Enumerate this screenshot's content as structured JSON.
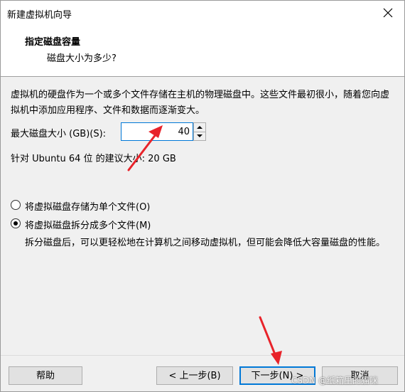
{
  "window": {
    "title": "新建虚拟机向导",
    "close_icon": "close-icon"
  },
  "header": {
    "title": "指定磁盘容量",
    "subtitle": "磁盘大小为多少?"
  },
  "description": "虚拟机的硬盘作为一个或多个文件存储在主机的物理磁盘中。这些文件最初很小，随着您向虚拟机中添加应用程序、文件和数据而逐渐变大。",
  "disk_size": {
    "label": "最大磁盘大小 (GB)(S):",
    "value": "40"
  },
  "recommendation": "针对 Ubuntu 64 位 的建议大小: 20 GB",
  "storage_options": [
    {
      "label": "将虚拟磁盘存储为单个文件(O)",
      "selected": false
    },
    {
      "label": "将虚拟磁盘拆分成多个文件(M)",
      "selected": true
    }
  ],
  "split_description": "拆分磁盘后，可以更轻松地在计算机之间移动虚拟机，但可能会降低大容量磁盘的性能。",
  "buttons": {
    "help": "帮助",
    "back": "< 上一步(B)",
    "next": "下一步(N) >",
    "cancel": "取消"
  },
  "annotation_color": "#e8232a",
  "watermark": "CSDN @纸箱里的猫咪"
}
